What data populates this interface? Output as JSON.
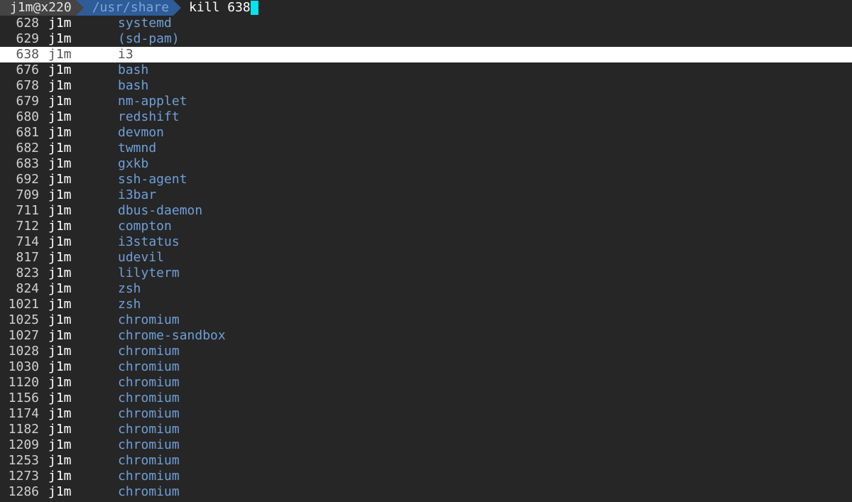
{
  "prompt": {
    "user_host": "j1m@x220",
    "path": "/usr/share",
    "command": "kill 638"
  },
  "processes": [
    {
      "pid": "628",
      "user": "j1m",
      "name": "systemd"
    },
    {
      "pid": "629",
      "user": "j1m",
      "name": "(sd-pam)"
    },
    {
      "pid": "638",
      "user": "j1m",
      "name": "i3",
      "selected": true
    },
    {
      "pid": "676",
      "user": "j1m",
      "name": "bash"
    },
    {
      "pid": "678",
      "user": "j1m",
      "name": "bash"
    },
    {
      "pid": "679",
      "user": "j1m",
      "name": "nm-applet"
    },
    {
      "pid": "680",
      "user": "j1m",
      "name": "redshift"
    },
    {
      "pid": "681",
      "user": "j1m",
      "name": "devmon"
    },
    {
      "pid": "682",
      "user": "j1m",
      "name": "twmnd"
    },
    {
      "pid": "683",
      "user": "j1m",
      "name": "gxkb"
    },
    {
      "pid": "692",
      "user": "j1m",
      "name": "ssh-agent"
    },
    {
      "pid": "709",
      "user": "j1m",
      "name": "i3bar"
    },
    {
      "pid": "711",
      "user": "j1m",
      "name": "dbus-daemon"
    },
    {
      "pid": "712",
      "user": "j1m",
      "name": "compton"
    },
    {
      "pid": "714",
      "user": "j1m",
      "name": "i3status"
    },
    {
      "pid": "817",
      "user": "j1m",
      "name": "udevil"
    },
    {
      "pid": "823",
      "user": "j1m",
      "name": "lilyterm"
    },
    {
      "pid": "824",
      "user": "j1m",
      "name": "zsh"
    },
    {
      "pid": "1021",
      "user": "j1m",
      "name": "zsh"
    },
    {
      "pid": "1025",
      "user": "j1m",
      "name": "chromium"
    },
    {
      "pid": "1027",
      "user": "j1m",
      "name": "chrome-sandbox"
    },
    {
      "pid": "1028",
      "user": "j1m",
      "name": "chromium"
    },
    {
      "pid": "1030",
      "user": "j1m",
      "name": "chromium"
    },
    {
      "pid": "1120",
      "user": "j1m",
      "name": "chromium"
    },
    {
      "pid": "1156",
      "user": "j1m",
      "name": "chromium"
    },
    {
      "pid": "1174",
      "user": "j1m",
      "name": "chromium"
    },
    {
      "pid": "1182",
      "user": "j1m",
      "name": "chromium"
    },
    {
      "pid": "1209",
      "user": "j1m",
      "name": "chromium"
    },
    {
      "pid": "1253",
      "user": "j1m",
      "name": "chromium"
    },
    {
      "pid": "1273",
      "user": "j1m",
      "name": "chromium"
    },
    {
      "pid": "1286",
      "user": "j1m",
      "name": "chromium"
    }
  ]
}
